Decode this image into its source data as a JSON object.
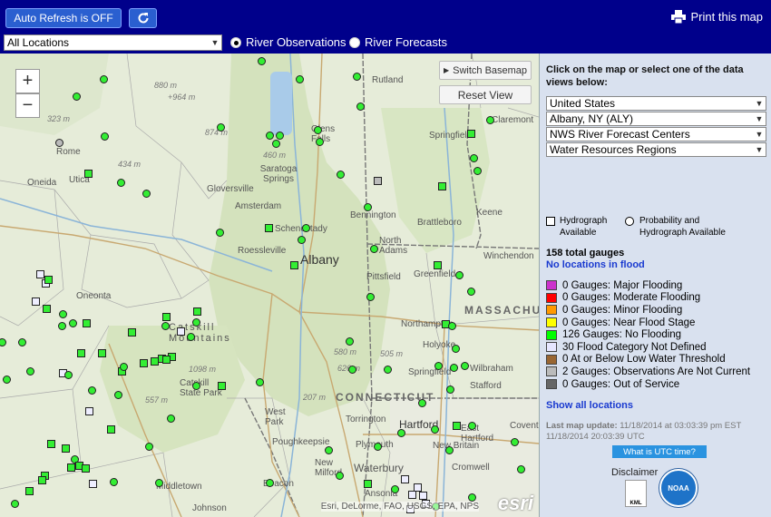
{
  "toolbar": {
    "refresh_label": "Auto Refresh is OFF",
    "print_label": "Print this map",
    "location_value": "All Locations",
    "radio_observations": "River Observations",
    "radio_forecasts": "River Forecasts",
    "selected_radio": "River Observations"
  },
  "map": {
    "switch_basemap_label": "Switch Basemap",
    "reset_view_label": "Reset View",
    "zoom_in_label": "+",
    "zoom_out_label": "−",
    "attribution": "Esri, DeLorme, FAO, USGS, EPA, NPS",
    "logo_text": "esri",
    "labels": {
      "rutland": "Rutland",
      "claremont": "Claremont",
      "springfield_vt": "Springfield",
      "rome": "Rome",
      "utica": "Utica",
      "oneida": "Oneida",
      "glens_falls": "Glens Falls",
      "saratoga": "Saratoga Springs",
      "gloversville": "Gloversville",
      "amsterdam": "Amsterdam",
      "schenectady": "Schenectady",
      "albany": "Albany",
      "roessleville": "Roessleville",
      "bennington": "Bennington",
      "brattleboro": "Brattleboro",
      "keene": "Keene",
      "north_adams": "North Adams",
      "winchendon": "Winchendon",
      "greenfield": "Greenfield",
      "oneonta": "Oneonta",
      "pittsfield": "Pittsfield",
      "northampton": "Northampton",
      "holyoke": "Holyoke",
      "springfield_ma": "Springfield",
      "wilbraham": "Wilbraham",
      "stafford": "Stafford",
      "catskill": "Catskill State Park",
      "catskill_mtns": "Catskill Mountains",
      "massachusetts": "MASSACHUSETTS",
      "connecticut": "CONNECTICUT",
      "torrington": "Torrington",
      "west_park": "West Park",
      "poughkeepsie": "Poughkeepsie",
      "hartford": "Hartford",
      "east_hartford": "East Hartford",
      "new_britain": "New Britain",
      "coventry": "Coventry",
      "plymouth": "Plymouth",
      "new_milford": "New Milford",
      "waterbury": "Waterbury",
      "cromwell": "Cromwell",
      "beacon": "Beacon",
      "middletown": "Middletown",
      "johnson": "Johnson",
      "ansonia": "Ansonia"
    },
    "elevations": [
      "880 m",
      "+964 m",
      "323 m",
      "874 m",
      "434 m",
      "460 m",
      "580 m",
      "505 m",
      "626 m",
      "1098 m",
      "557 m",
      "207 m",
      "323 m",
      "460 m"
    ]
  },
  "panel": {
    "instructions": "Click on the map or select one of the data views below:",
    "selects": [
      "United States",
      "Albany, NY (ALY)",
      "NWS River Forecast Centers",
      "Water Resources Regions"
    ],
    "hydrograph_label": "Hydrograph Available",
    "probability_label": "Probability and Hydrograph Available",
    "total_gauges": "158 total gauges",
    "flood_status": "No locations in flood",
    "categories": [
      {
        "label": "0 Gauges: Major Flooding",
        "color": "#cc33cc"
      },
      {
        "label": "0 Gauges: Moderate Flooding",
        "color": "#ff0000"
      },
      {
        "label": "0 Gauges: Minor Flooding",
        "color": "#ff9900"
      },
      {
        "label": "0 Gauges: Near Flood Stage",
        "color": "#ffff00"
      },
      {
        "label": "126 Gauges: No Flooding",
        "color": "#00ff00"
      },
      {
        "label": "30 Flood Category Not Defined",
        "color": "#e6e6ff"
      },
      {
        "label": "0 At or Below Low Water Threshold",
        "color": "#996633"
      },
      {
        "label": "2 Gauges: Observations Are Not Current",
        "color": "#bbbbbb"
      },
      {
        "label": "0 Gauges: Out of Service",
        "color": "#666666"
      }
    ],
    "show_all": "Show all locations",
    "last_update_label": "Last map update:",
    "last_update_est": "11/18/2014 at 03:03:39 pm EST",
    "last_update_utc": "11/18/2014 20:03:39 UTC",
    "utc_button": "What is UTC time?",
    "disclaimer": "Disclaimer",
    "kml_text": "KML",
    "noaa_text": "NOAA"
  }
}
